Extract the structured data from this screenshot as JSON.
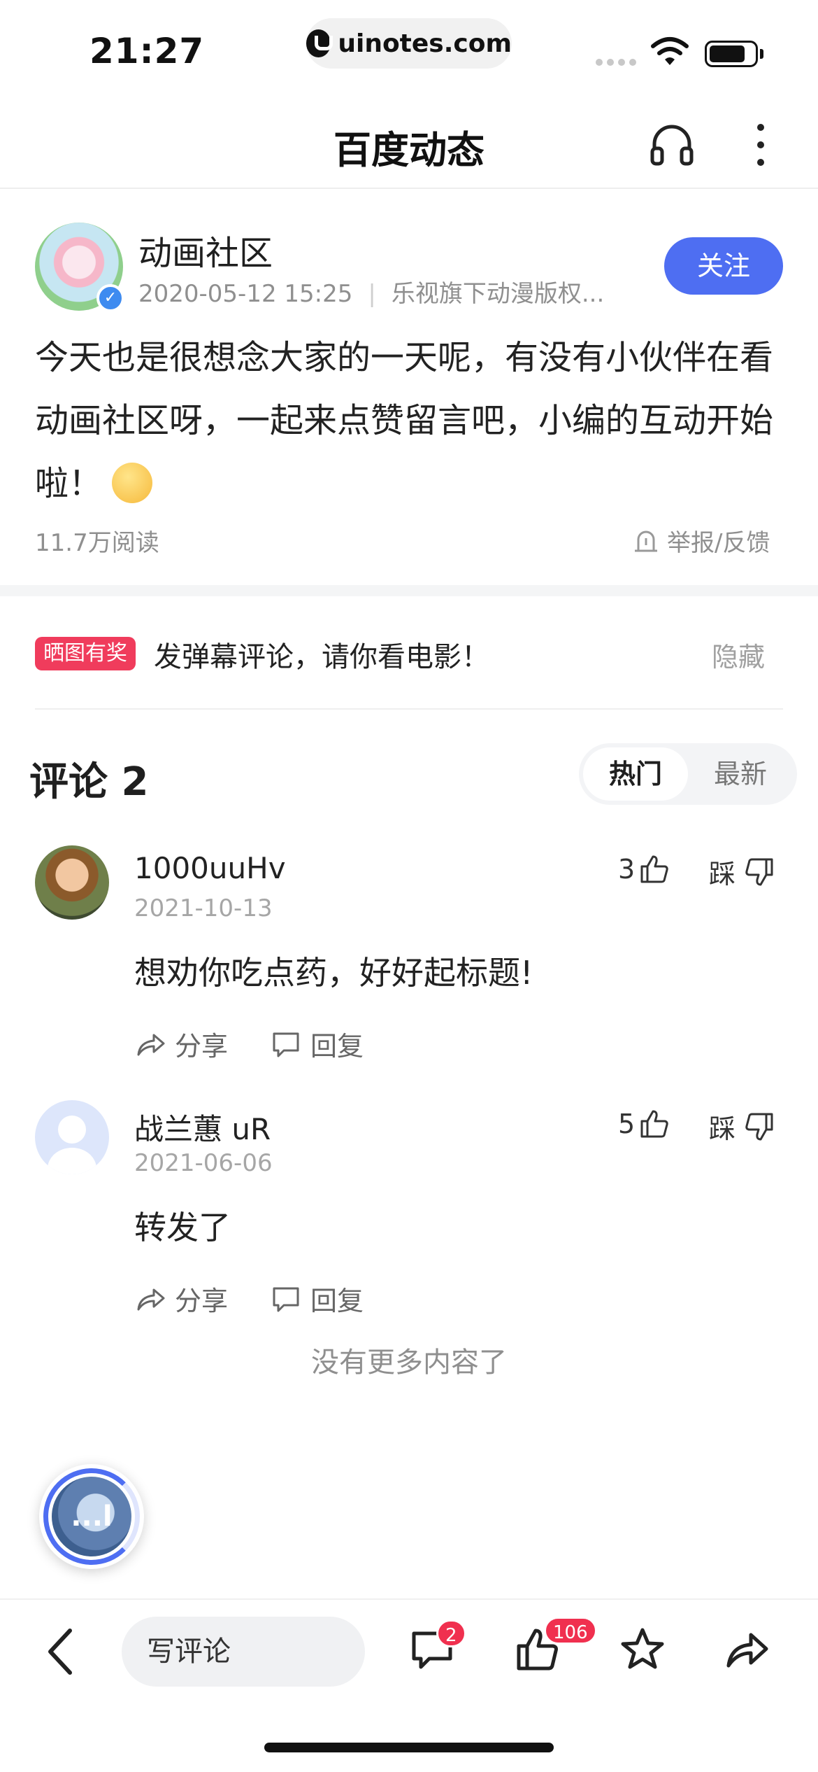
{
  "status_bar": {
    "time": "21:27",
    "url": "uinotes.com"
  },
  "nav": {
    "title": "百度动态"
  },
  "post": {
    "author": "动画社区",
    "date": "2020-05-12 15:25",
    "source": "乐视旗下动漫版权...",
    "follow_label": "关注",
    "body": "今天也是很想念大家的一天呢，有没有小伙伴在看动画社区呀，一起来点赞留言吧，小编的互动开始啦！",
    "read_count": "11.7万阅读",
    "report_label": "举报/反馈"
  },
  "promo": {
    "badge": "晒图有奖",
    "text": "发弹幕评论，请你看电影！",
    "hide_label": "隐藏"
  },
  "comments_header": {
    "title": "评论 2",
    "tab_hot": "热门",
    "tab_new": "最新"
  },
  "comments": [
    {
      "name": "1000uuHv",
      "date": "2021-10-13",
      "text": "想劝你吃点药，好好起标题!",
      "likes": "3",
      "dislike_label": "踩",
      "share_label": "分享",
      "reply_label": "回复"
    },
    {
      "name": "战兰蕙 uR",
      "date": "2021-06-06",
      "text": "转发了",
      "likes": "5",
      "dislike_label": "踩",
      "share_label": "分享",
      "reply_label": "回复"
    }
  ],
  "no_more": "没有更多内容了",
  "float_ball": {
    "label": "...l"
  },
  "bottom_bar": {
    "input_placeholder": "写评论",
    "comment_badge": "2",
    "like_badge": "106"
  },
  "colors": {
    "accent": "#4e6ef2",
    "badge": "#f0304f",
    "promo_badge": "#f03c5c"
  }
}
